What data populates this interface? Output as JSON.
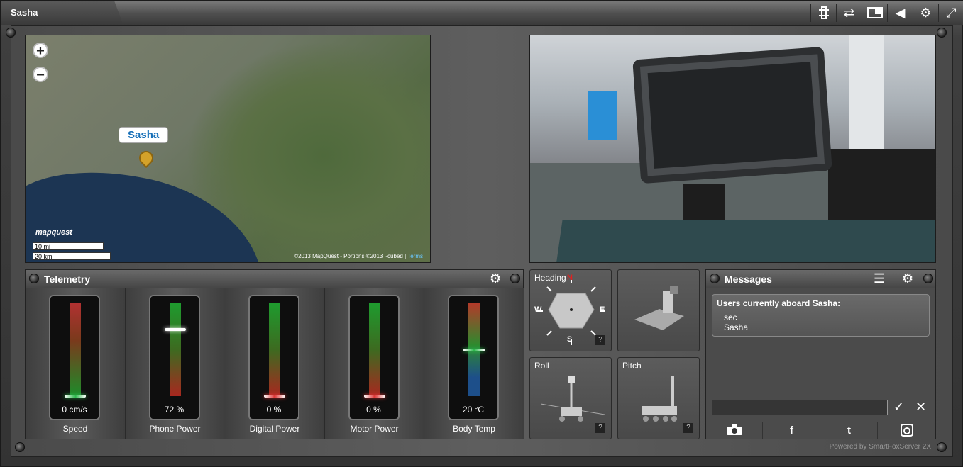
{
  "window": {
    "title": "Sasha"
  },
  "map": {
    "zoom_in": "+",
    "zoom_out": "−",
    "marker_label": "Sasha",
    "logo": "mapquest",
    "scale_mi": "10 mi",
    "scale_km": "20 km",
    "copyright": "©2013 MapQuest - Portions  ©2013 i-cubed | ",
    "terms": "Terms"
  },
  "telemetry": {
    "title": "Telemetry",
    "gauges": [
      {
        "label": "Speed",
        "value": "0 cm/s",
        "level": 0.0
      },
      {
        "label": "Phone Power",
        "value": "72 %",
        "level": 0.72
      },
      {
        "label": "Digital Power",
        "value": "0 %",
        "level": 0.0
      },
      {
        "label": "Motor Power",
        "value": "0 %",
        "level": 0.0
      },
      {
        "label": "Body Temp",
        "value": "20 °C",
        "level": 0.5
      }
    ]
  },
  "orientation": {
    "heading": "Heading",
    "roll": "Roll",
    "pitch": "Pitch",
    "help": "?",
    "compass": {
      "n": "N",
      "s": "S",
      "e": "E",
      "w": "W"
    }
  },
  "messages": {
    "title": "Messages",
    "users_heading": "Users currently aboard Sasha:",
    "users": [
      "sec",
      "Sasha"
    ],
    "input_value": ""
  },
  "footer": {
    "powered_by": "Powered by SmartFoxServer 2X"
  },
  "colors": {
    "accent_blue": "#1870b8",
    "link_cyan": "#6bc8ff",
    "pin_gold": "#d4a22a"
  }
}
